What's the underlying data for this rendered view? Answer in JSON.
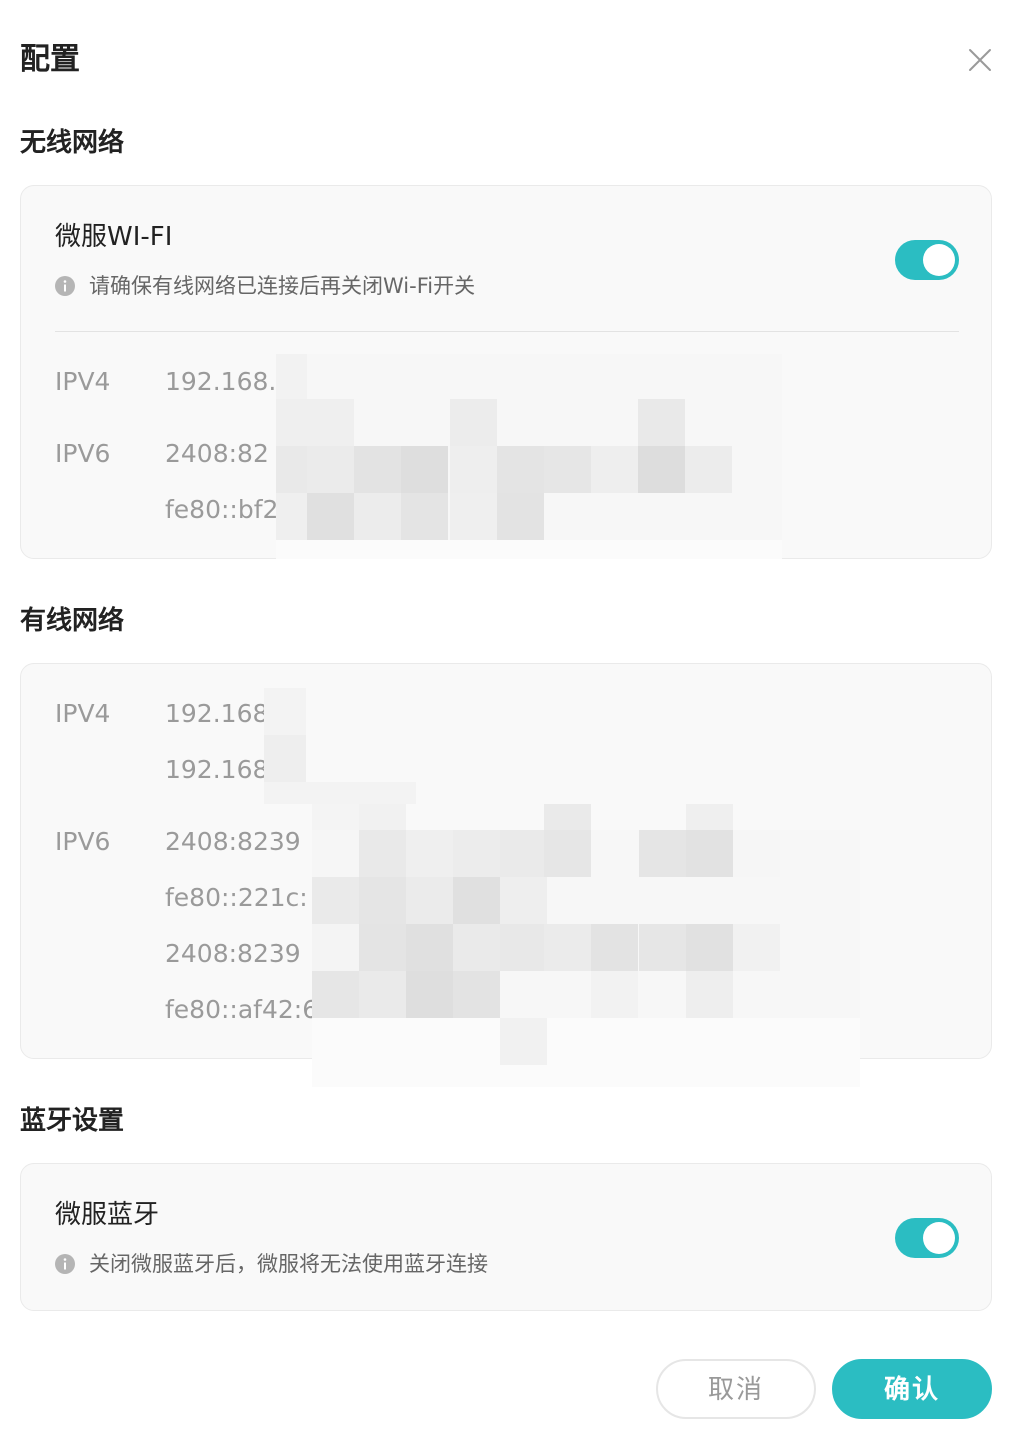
{
  "dialog": {
    "title": "配置",
    "close_icon": "close-icon"
  },
  "wireless": {
    "section_title": "无线网络",
    "wifi_label": "微服WI-FI",
    "wifi_enabled": true,
    "wifi_hint": "请确保有线网络已连接后再关闭Wi-Fi开关",
    "ipv4_key": "IPV4",
    "ipv4_values": [
      "192.168.5"
    ],
    "ipv6_key": "IPV6",
    "ipv6_values": [
      "2408:82",
      "fe80::bf2"
    ]
  },
  "wired": {
    "section_title": "有线网络",
    "ipv4_key": "IPV4",
    "ipv4_values": [
      "192.168",
      "192.168"
    ],
    "ipv6_key": "IPV6",
    "ipv6_values": [
      "2408:8239",
      "fe80::221c:",
      "2408:8239",
      "fe80::af42:6"
    ]
  },
  "bluetooth": {
    "section_title": "蓝牙设置",
    "bt_label": "微服蓝牙",
    "bt_enabled": true,
    "bt_hint": "关闭微服蓝牙后，微服将无法使用蓝牙连接"
  },
  "footer": {
    "cancel_label": "取消",
    "confirm_label": "确认"
  },
  "colors": {
    "accent": "#2bbdc2",
    "card_bg": "#f9f9f9",
    "muted_text": "#9a9a9a"
  }
}
